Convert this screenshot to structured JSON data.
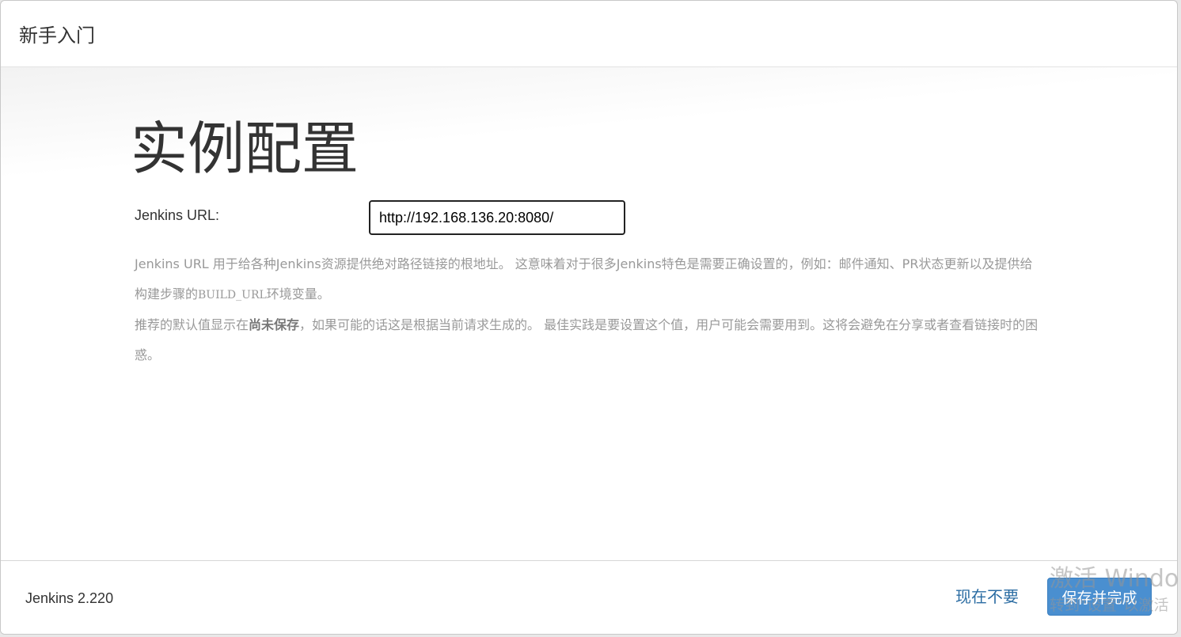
{
  "dialog": {
    "title": "新手入门"
  },
  "main": {
    "heading": "实例配置",
    "url_label": "Jenkins URL:",
    "url_value": "http://192.168.136.20:8080/",
    "help": {
      "line1_a": "Jenkins URL 用于给各种Jenkins资源提供绝对路径链接的根地址。 这意味着对于很多Jenkins特色是需要正确设置的，例如：邮件通知、PR状态更新以及提供给构建步骤的",
      "line1_code": "BUILD_URL",
      "line1_b": "环境变量。",
      "line2_a": "推荐的默认值显示在",
      "line2_strong": "尚未保存",
      "line2_b": "，如果可能的话这是根据当前请求生成的。 最佳实践是要设置这个值，用户可能会需要用到。这将会避免在分享或者查看链接时的困惑。"
    }
  },
  "footer": {
    "version": "Jenkins 2.220",
    "skip_label": "现在不要",
    "save_label": "保存并完成"
  },
  "watermark": {
    "line1": "激活 Windo",
    "line2": "转到\"设置\"以激活"
  },
  "colors": {
    "primary_button": "#4a8fd0",
    "link": "#2c6da3"
  }
}
